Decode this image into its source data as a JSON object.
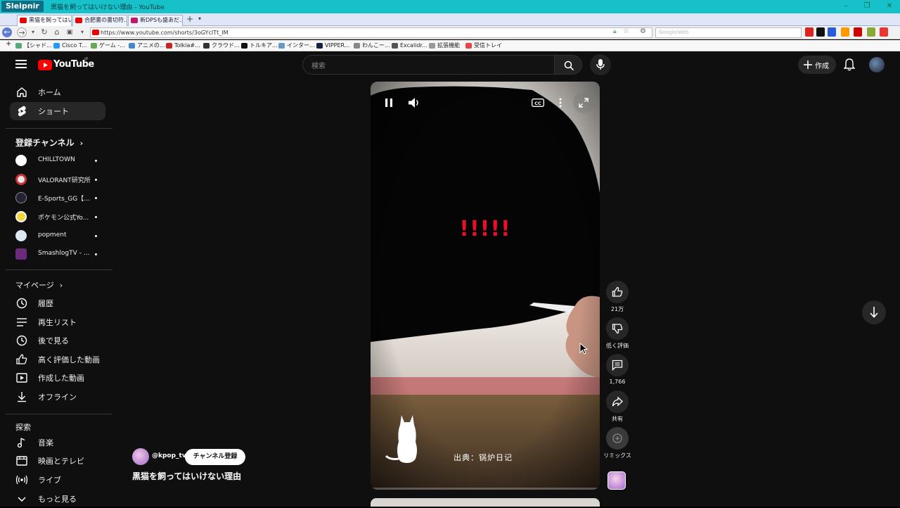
{
  "browser": {
    "brand": "Sleipnir",
    "window_title": "黒猫を飼ってはいけない理由 - YouTube",
    "tabs": [
      {
        "label": "黒猫を飼ってはい..."
      },
      {
        "label": "合肥書の書切符..."
      },
      {
        "label": "新DPSも盛あだ..."
      }
    ],
    "url": "https://www.youtube.com/shorts/3oGYcITt_IM",
    "search_placeholder": "Google/Web",
    "bookmarks": [
      {
        "label": "【シャド..."
      },
      {
        "label": "Cisco T..."
      },
      {
        "label": "ゲーム -..."
      },
      {
        "label": "アニメの..."
      },
      {
        "label": "Tolkia#..."
      },
      {
        "label": "クラウド..."
      },
      {
        "label": "トルキア..."
      },
      {
        "label": "インター..."
      },
      {
        "label": "VIPPER..."
      },
      {
        "label": "わんこー..."
      },
      {
        "label": "Excalidr..."
      },
      {
        "label": "拡張機能"
      },
      {
        "label": "受信トレイ"
      }
    ]
  },
  "youtube": {
    "logo_text": "YouTube",
    "logo_region": "JP",
    "search_placeholder": "検索",
    "create_label": "作成",
    "sidebar": {
      "main": [
        {
          "label": "ホーム"
        },
        {
          "label": "ショート"
        }
      ],
      "subs_header": "登録チャンネル",
      "channels": [
        {
          "label": "CHILLTOWN"
        },
        {
          "label": "VALORANT研究所"
        },
        {
          "label": "E-Sports_GG【V..."
        },
        {
          "label": "ポケモン公式Yo..."
        },
        {
          "label": "popment"
        },
        {
          "label": "SmashlogTV - V..."
        }
      ],
      "mypage_header": "マイページ",
      "mypage": [
        {
          "label": "履歴"
        },
        {
          "label": "再生リスト"
        },
        {
          "label": "後で見る"
        },
        {
          "label": "高く評価した動画"
        },
        {
          "label": "作成した動画"
        },
        {
          "label": "オフライン"
        }
      ],
      "explore_header": "探索",
      "explore": [
        {
          "label": "音楽"
        },
        {
          "label": "映画とテレビ"
        },
        {
          "label": "ライブ"
        },
        {
          "label": "もっと見る"
        }
      ]
    },
    "short": {
      "overlay_text": "!!!!!",
      "caption": "出典：锅炉日记",
      "channel_handle": "@kpop_tv",
      "subscribe_label": "チャンネル登録",
      "title": "黒猫を飼ってはいけない理由"
    },
    "actions": {
      "like_count": "21万",
      "dislike_label": "低く評価",
      "comment_count": "1,766",
      "share_label": "共有",
      "remix_label": "リミックス"
    }
  }
}
